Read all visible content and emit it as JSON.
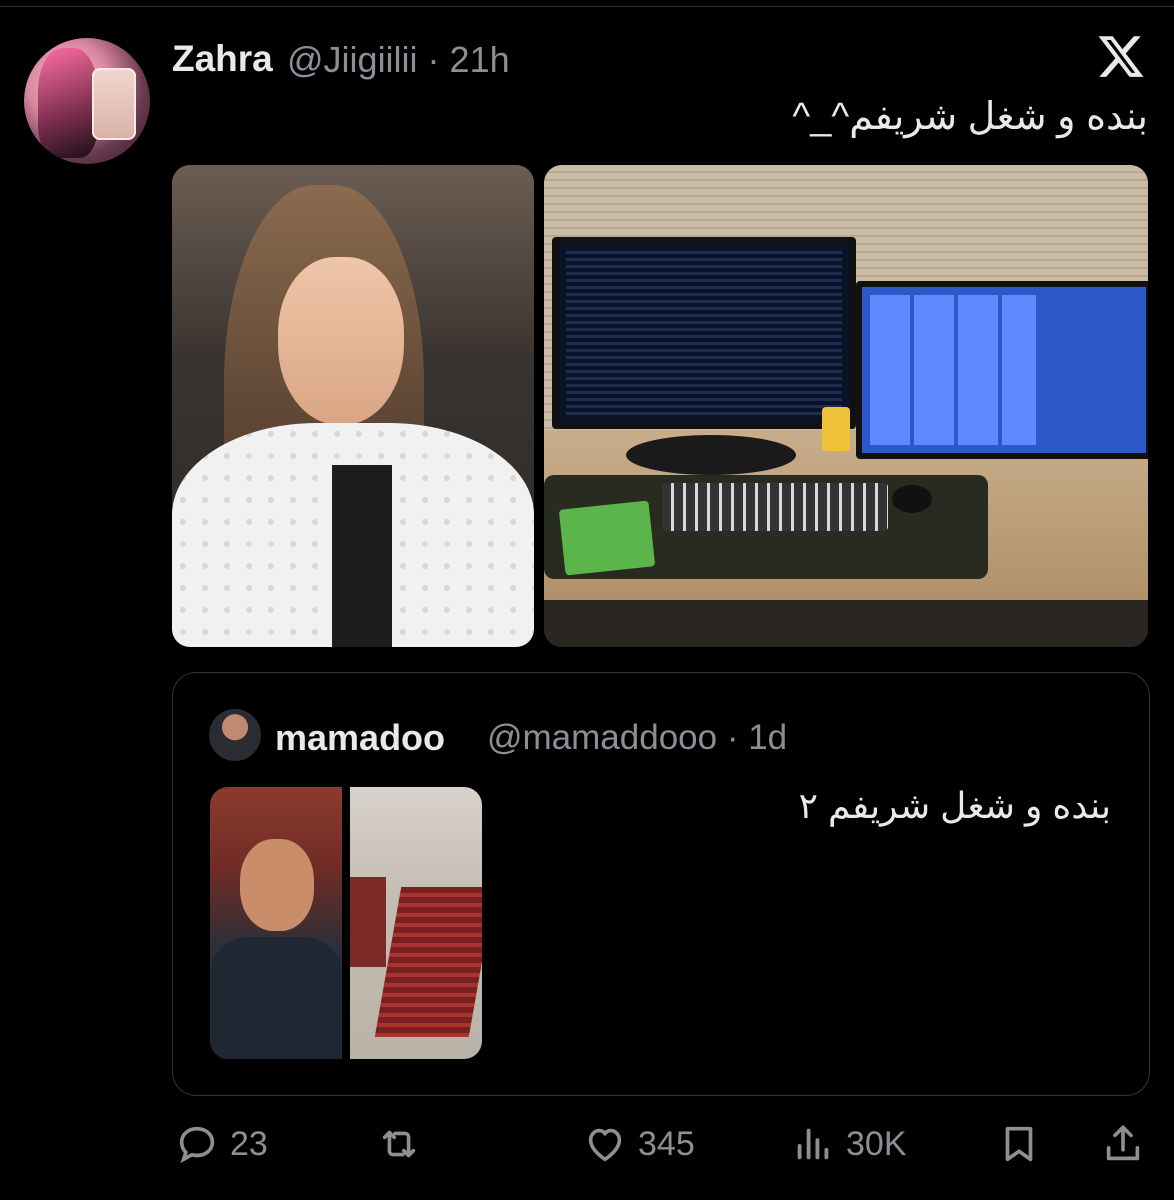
{
  "tweet": {
    "author_name": "Zahra",
    "author_handle_time": "@Jiigiilii · 21h",
    "text": "بنده و شغل شریفم^_^"
  },
  "quoted_tweet": {
    "author_name": "mamadoo",
    "author_handle_time": "@mamaddooo · 1d",
    "text": "بنده و شغل شریفم ۲"
  },
  "actions": {
    "replies": "23",
    "likes": "345",
    "views": "30K"
  },
  "icons": [
    "x-logo-icon",
    "reply-icon",
    "retweet-icon",
    "like-icon",
    "views-icon",
    "bookmark-icon",
    "share-icon"
  ],
  "colors": {
    "background": "#000000",
    "text": "#e7e9ea",
    "muted": "#8b9095",
    "border": "#2f3336"
  }
}
